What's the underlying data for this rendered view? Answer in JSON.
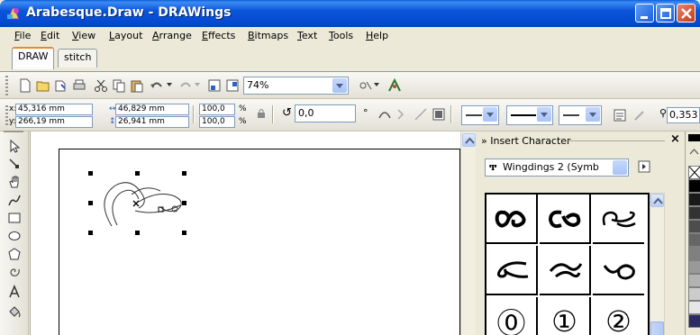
{
  "window": {
    "title": "Arabesque.Draw - DRAWings",
    "minimize_icon": "minimize-icon",
    "maximize_icon": "maximize-icon",
    "close_icon": "close-icon"
  },
  "menu": [
    {
      "label": "File"
    },
    {
      "label": "Edit"
    },
    {
      "label": "View"
    },
    {
      "label": "Layout"
    },
    {
      "label": "Arrange"
    },
    {
      "label": "Effects"
    },
    {
      "label": "Bitmaps"
    },
    {
      "label": "Text"
    },
    {
      "label": "Tools"
    },
    {
      "label": "Help"
    }
  ],
  "tabs": [
    {
      "label": "DRAW",
      "active": true
    },
    {
      "label": "stitch",
      "active": false
    }
  ],
  "toolbar": {
    "zoom": "74%"
  },
  "property_bar": {
    "x_label": "x:",
    "y_label": "y:",
    "x_value": "45,316 mm",
    "y_value": "266,19 mm",
    "width_value": "46,829 mm",
    "height_value": "26,941 mm",
    "scale_x": "100,0",
    "scale_y": "100,0",
    "percent": "%",
    "rotation": "0,0",
    "degree": "°",
    "outline_width": "0,353"
  },
  "docker": {
    "title": "» Insert Character",
    "close": "×",
    "font": "Wingdings 2 (Symb",
    "characters": [
      "ꔀ",
      "ꔁ",
      "ꔂ",
      "ꔃ",
      "ꔄ",
      "ꔅ",
      "⓪",
      "①",
      "②"
    ]
  },
  "colors": {
    "accent": "#0a5fd8",
    "palette": [
      "#ffffff",
      "#000000",
      "#1a1a1a",
      "#333333",
      "#4d4d4d",
      "#666666",
      "#808080",
      "#999999",
      "#b3b3b3",
      "#cccccc",
      "#e6e6e6",
      "#2b2b66"
    ]
  }
}
